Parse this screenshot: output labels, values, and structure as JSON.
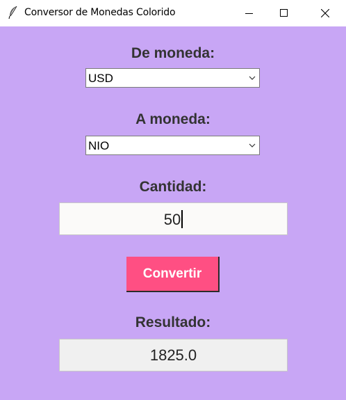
{
  "window": {
    "title": "Conversor de Monedas Colorido",
    "app_icon": "feather-icon",
    "controls": [
      "minimize-icon",
      "maximize-icon",
      "close-icon"
    ]
  },
  "form": {
    "from_label": "De moneda:",
    "from_value": "USD",
    "to_label": "A moneda:",
    "to_value": "NIO",
    "amount_label": "Cantidad:",
    "amount_value": "50",
    "convert_label": "Convertir",
    "result_label": "Resultado:",
    "result_value": "1825.0"
  },
  "colors": {
    "background": "#c8a6f5",
    "button": "#ff4f83",
    "label_text": "#333333"
  }
}
